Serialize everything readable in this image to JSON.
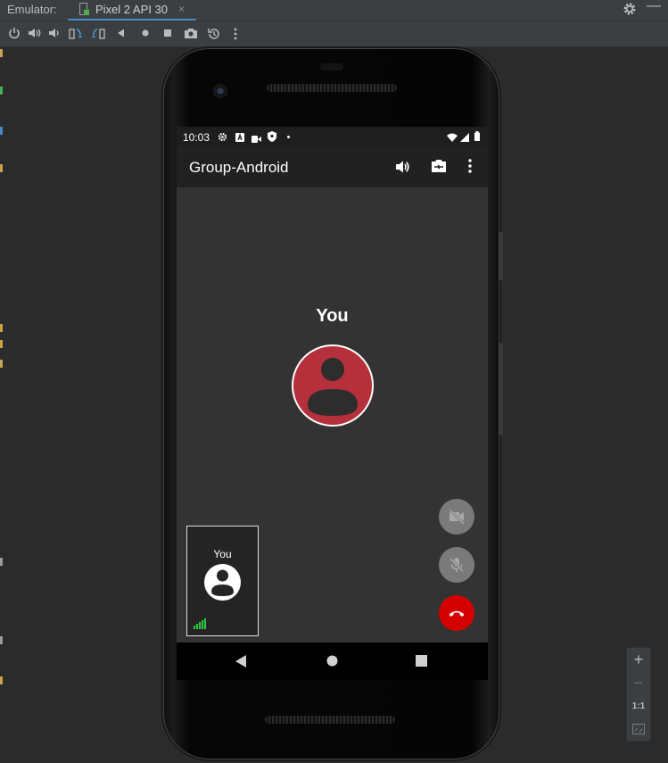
{
  "emulator": {
    "label": "Emulator:",
    "tab_title": "Pixel 2 API 30",
    "tab_close": "×",
    "minimize": "—"
  },
  "toolbar": {
    "icons": [
      "power-icon",
      "volume-up-icon",
      "volume-down-icon",
      "rotate-left-icon",
      "rotate-right-icon",
      "back-icon",
      "home-icon",
      "overview-icon",
      "screenshot-icon",
      "snapshot-icon",
      "more-icon"
    ]
  },
  "statusbar": {
    "time": "10:03"
  },
  "appbar": {
    "title": "Group-Android"
  },
  "call": {
    "main_name": "You",
    "thumb_name": "You"
  },
  "zoom": {
    "plus": "+",
    "minus": "−",
    "one_to_one": "1:1"
  },
  "colors": {
    "avatar_main": "#b5303a",
    "end_call": "#d50000",
    "fab_disabled": "#7a7a7a",
    "signal": "#2ecc40",
    "accent_tab": "#4a88c7"
  }
}
